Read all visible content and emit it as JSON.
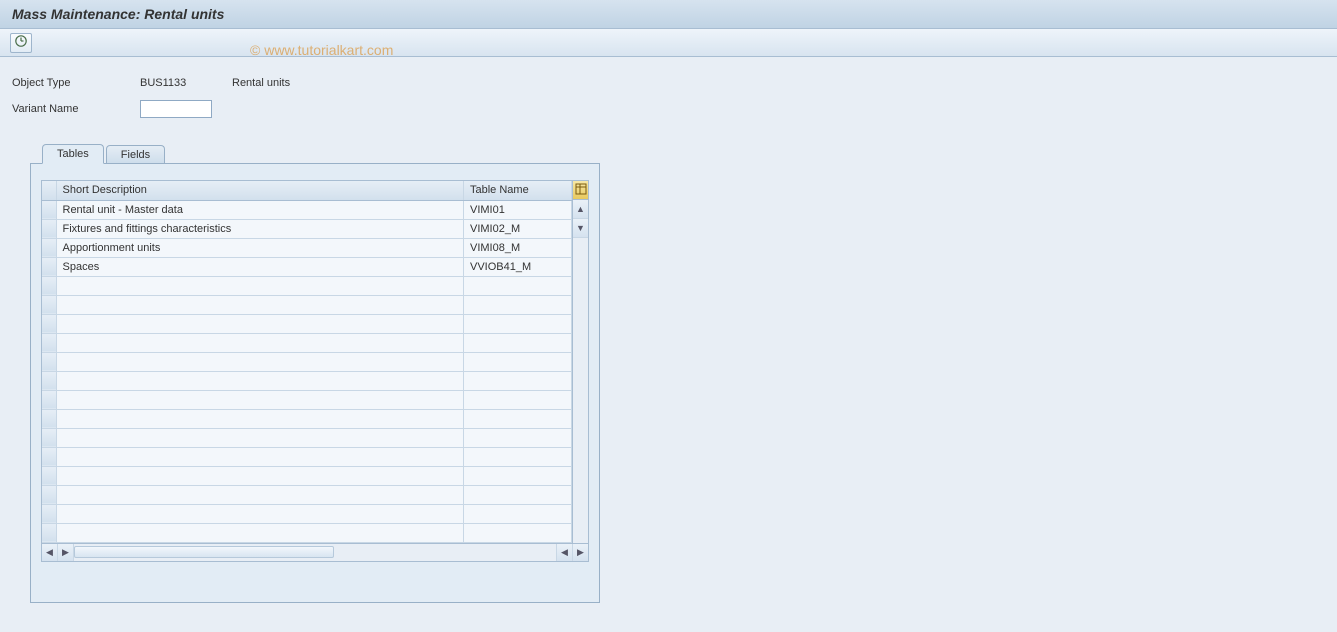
{
  "title": "Mass Maintenance: Rental units",
  "watermark": "© www.tutorialkart.com",
  "form": {
    "object_type_label": "Object Type",
    "object_type_value": "BUS1133",
    "object_type_desc": "Rental units",
    "variant_name_label": "Variant Name",
    "variant_name_value": ""
  },
  "tabs": {
    "tables": "Tables",
    "fields": "Fields"
  },
  "table": {
    "columns": {
      "short_desc": "Short Description",
      "table_name": "Table Name"
    },
    "rows": [
      {
        "short_desc": "Rental unit - Master data",
        "table_name": "VIMI01"
      },
      {
        "short_desc": "Fixtures and fittings characteristics",
        "table_name": "VIMI02_M"
      },
      {
        "short_desc": "Apportionment units",
        "table_name": "VIMI08_M"
      },
      {
        "short_desc": "Spaces",
        "table_name": "VVIOB41_M"
      }
    ]
  }
}
